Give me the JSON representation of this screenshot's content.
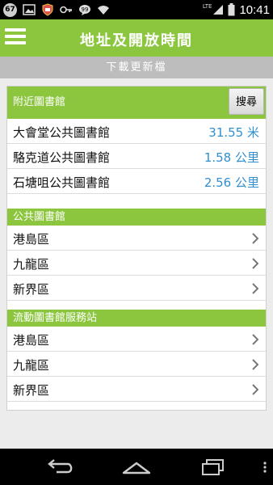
{
  "status_bar": {
    "notification_count": "67",
    "network": "LTE",
    "time": "10:41"
  },
  "app_bar": {
    "title": "地址及開放時間"
  },
  "download_bar": {
    "label": "下載更新檔"
  },
  "nearby": {
    "heading": "附近圖書館",
    "search_label": "搜尋",
    "items": [
      {
        "name": "大會堂公共圖書館",
        "distance": "31.55 米"
      },
      {
        "name": "駱克道公共圖書館",
        "distance": "1.58 公里"
      },
      {
        "name": "石塘咀公共圖書館",
        "distance": "2.56 公里"
      }
    ]
  },
  "public_libraries": {
    "heading": "公共圖書館",
    "items": [
      {
        "label": "港島區"
      },
      {
        "label": "九龍區"
      },
      {
        "label": "新界區"
      }
    ]
  },
  "mobile_libraries": {
    "heading": "流動圖書館服務站",
    "items": [
      {
        "label": "港島區"
      },
      {
        "label": "九龍區"
      },
      {
        "label": "新界區"
      }
    ]
  },
  "colors": {
    "accent_green": "#8cc63f",
    "distance_blue": "#2f8fcf",
    "download_bar_gray": "#bdbdbd"
  },
  "icons": {
    "status_left": [
      "notification-count-badge",
      "image-icon",
      "shield-icon",
      "key-icon",
      "chat-bubble-icon",
      "wifi-icon"
    ],
    "status_right": [
      "signal-icon",
      "battery-icon"
    ],
    "app_bar": [
      "menu-icon"
    ],
    "list": [
      "chevron-right-icon"
    ],
    "nav": [
      "back-icon",
      "home-icon",
      "recent-apps-icon"
    ]
  }
}
